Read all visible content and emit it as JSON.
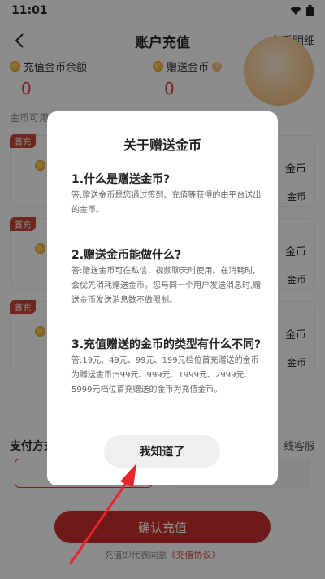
{
  "status": {
    "time": "11:01"
  },
  "header": {
    "title": "账户充值",
    "detail_link": "金币明细"
  },
  "balance": {
    "recharge_label": "充值金币余额",
    "recharge_value": "0",
    "gift_label": "赠送金币",
    "gift_value": "0"
  },
  "usable_label": "金币可用",
  "cards": {
    "badge": "首充",
    "right_amount_label": "金币"
  },
  "payment": {
    "title": "支付方式",
    "service": "线客服"
  },
  "confirm_label": "确认充值",
  "agreement": {
    "prefix": "充值即代表同意",
    "link": "《充值协议》"
  },
  "dialog": {
    "title": "关于赠送金币",
    "q1": "1.什么是赠送金币?",
    "a1": "答:赠送金币是您通过签到、充值等获得的由平台送出的金币。",
    "q2": "2.赠送金币能做什么?",
    "a2": "答:赠送金币可在私信、视频聊天时使用。在消耗时,会优先消耗赠送金币。您与同一个用户发送消息时,赠送金币发送消息数不做限制。",
    "q3": "3.充值赠送的金币的类型有什么不同?",
    "a3": "答:19元、49元、99元、199元档位首充赠送的金币为赠送金币;599元、999元、1999元、2999元、5999元档位首充赠送的金币为充值金币。",
    "ok_label": "我知道了"
  },
  "colors": {
    "accent": "#e0373b",
    "button": "#c9302c",
    "annotation": "#e8242b"
  }
}
